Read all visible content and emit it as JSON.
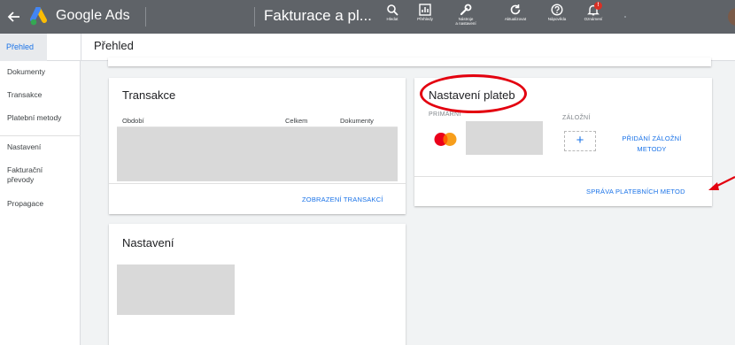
{
  "app": {
    "brand": "Google Ads",
    "page_title": "Fakturace a pl..."
  },
  "toolbar": {
    "items": [
      {
        "label": "Hledat",
        "icon": "search-icon"
      },
      {
        "label": "Přehledy",
        "icon": "reports-icon"
      },
      {
        "label": "Nástroje\na nastavení",
        "icon": "wrench-icon"
      },
      {
        "label": "Aktualizovat",
        "icon": "refresh-icon"
      },
      {
        "label": "Nápověda",
        "icon": "help-icon"
      },
      {
        "label": "Oznámení",
        "icon": "bell-icon",
        "badge": "!"
      }
    ]
  },
  "subheader": {
    "selected_tab": "Přehled",
    "title": "Přehled"
  },
  "sidebar": {
    "items": [
      {
        "label": "Přehled"
      },
      {
        "label": "Dokumenty"
      },
      {
        "label": "Transakce"
      },
      {
        "label": "Platební metody"
      },
      {
        "label": "Nastavení"
      },
      {
        "label": "Fakturační převody"
      },
      {
        "label": "Propagace"
      }
    ]
  },
  "transactions_card": {
    "title": "Transakce",
    "columns": [
      "Období",
      "Celkem",
      "Dokumenty"
    ],
    "link": "ZOBRAZENÍ TRANSAKCÍ"
  },
  "payment_card": {
    "title": "Nastavení plateb",
    "primary_label": "PRIMÁRNÍ",
    "backup_label": "ZÁLOŽNÍ",
    "add_backup_link": "PŘIDÁNÍ ZÁLOŽNÍ METODY",
    "manage_link": "SPRÁVA PLATEBNÍCH METOD"
  },
  "settings_card": {
    "title": "Nastavení"
  },
  "colors": {
    "topbar": "#5f6368",
    "accent": "#1a73e8",
    "annotation": "#e3000f"
  }
}
